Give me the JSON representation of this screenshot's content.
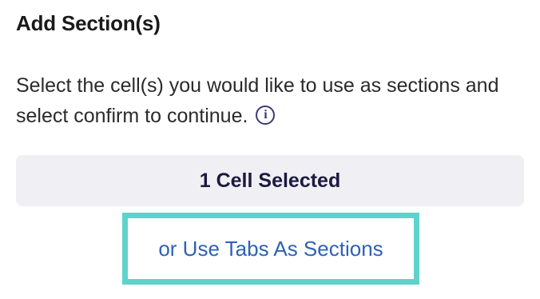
{
  "header": {
    "title": "Add Section(s)"
  },
  "instructions": {
    "text": "Select the cell(s) you would like to use as sections and select confirm to continue.",
    "info_icon": "info-icon"
  },
  "selection": {
    "label": "1 Cell Selected"
  },
  "alternate": {
    "link_label": "or Use Tabs As Sections",
    "highlight_color": "#5fd3cb",
    "link_color": "#2e62b4"
  }
}
